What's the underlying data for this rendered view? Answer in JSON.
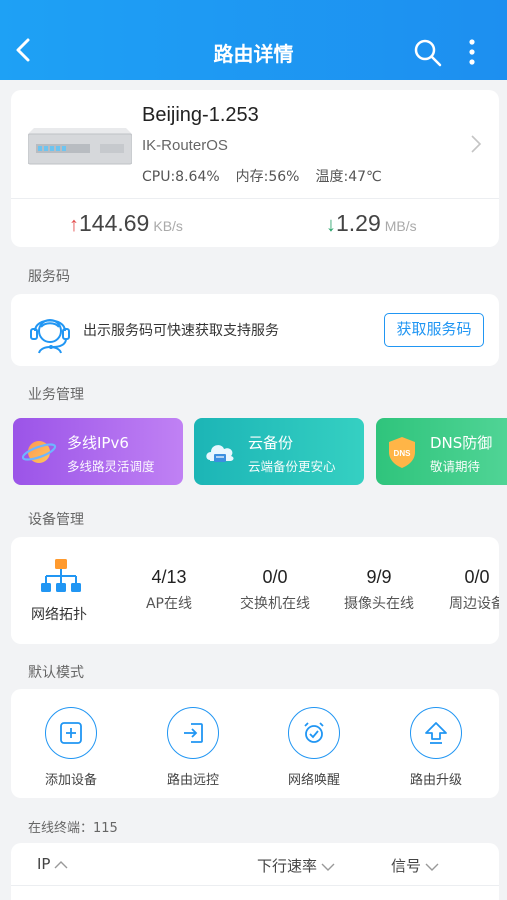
{
  "header": {
    "title": "路由详情"
  },
  "router": {
    "name": "Beijing-1.253",
    "os": "IK-RouterOS",
    "cpu": "CPU:8.64%",
    "memory": "内存:56%",
    "temperature": "温度:47℃",
    "upload": {
      "arrow": "↑",
      "value": "144.69",
      "unit": "KB/s"
    },
    "download": {
      "arrow": "↓",
      "value": "1.29",
      "unit": "MB/s"
    }
  },
  "service": {
    "section_label": "服务码",
    "text": "出示服务码可快速获取支持服务",
    "button": "获取服务码"
  },
  "business": {
    "section_label": "业务管理",
    "tiles": [
      {
        "title": "多线IPv6",
        "subtitle": "多线路灵活调度"
      },
      {
        "title": "云备份",
        "subtitle": "云端备份更安心"
      },
      {
        "title": "DNS防御",
        "subtitle": "敬请期待",
        "badge": "DNS"
      }
    ]
  },
  "devices": {
    "section_label": "设备管理",
    "topology_label": "网络拓扑",
    "stats": [
      {
        "value": "4/13",
        "label": "AP在线"
      },
      {
        "value": "0/0",
        "label": "交换机在线"
      },
      {
        "value": "9/9",
        "label": "摄像头在线"
      },
      {
        "value": "0/0",
        "label": "周边设备"
      }
    ]
  },
  "mode": {
    "section_label": "默认模式",
    "items": [
      {
        "label": "添加设备"
      },
      {
        "label": "路由远控"
      },
      {
        "label": "网络唤醒"
      },
      {
        "label": "路由升级"
      }
    ]
  },
  "online": {
    "label": "在线终端：115"
  },
  "table": {
    "columns": [
      {
        "label": "IP"
      },
      {
        "label": "下行速率"
      },
      {
        "label": "信号"
      }
    ]
  },
  "colors": {
    "primary": "#1e9cf5",
    "ipv6": "#a463ec",
    "backup": "#25c1bc",
    "dns": "#3ccb86"
  }
}
